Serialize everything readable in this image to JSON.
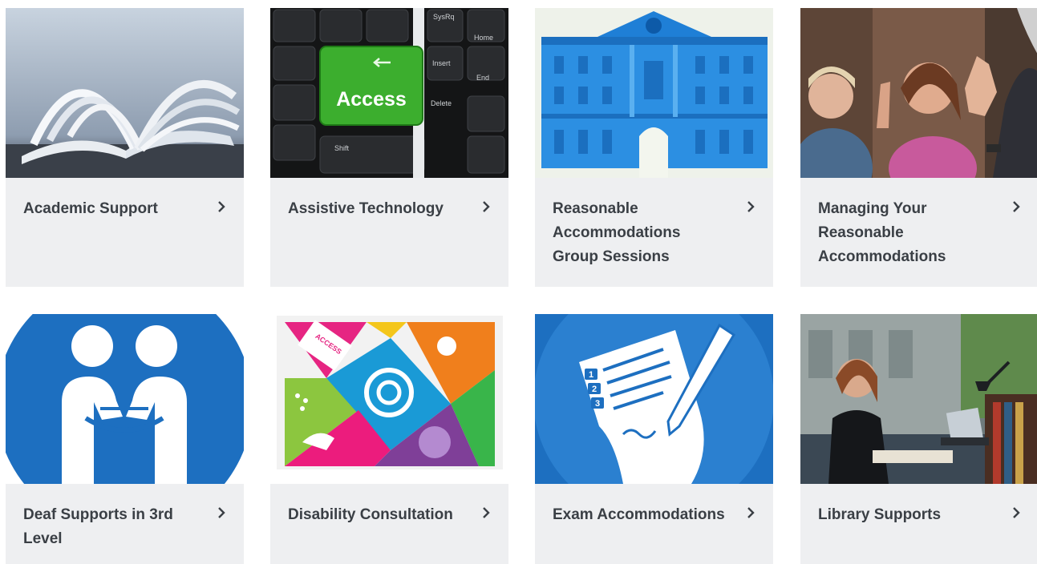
{
  "cards": [
    {
      "label": "Academic Support",
      "image": "open-book-photo"
    },
    {
      "label": "Assistive Technology",
      "image": "access-key-keyboard-photo"
    },
    {
      "label": "Reasonable Accommodations Group Sessions",
      "image": "building-illustration"
    },
    {
      "label": "Managing Your Reasonable Accommodations",
      "image": "people-conversation-photo"
    },
    {
      "label": "Deaf Supports in 3rd Level",
      "image": "handshake-icon-illustration"
    },
    {
      "label": "Disability Consultation",
      "image": "access-mosaic-illustration"
    },
    {
      "label": "Exam Accommodations",
      "image": "exam-paper-pen-illustration"
    },
    {
      "label": "Library Supports",
      "image": "student-library-photo"
    }
  ],
  "keyboard": {
    "key_access": "Access",
    "key_sysrq": "SysRq",
    "key_insert": "Insert",
    "key_home": "Home",
    "key_delete": "Delete",
    "key_end": "End",
    "key_shift": "Shift"
  },
  "mosaic": {
    "access_text": "ACCESS"
  },
  "exam": {
    "numbers": [
      "1",
      "2",
      "3"
    ]
  },
  "colors": {
    "panel": "#eeeff1",
    "text": "#3a3f45",
    "blue": "#1d6fc0",
    "key_green": "#3cae2e"
  }
}
